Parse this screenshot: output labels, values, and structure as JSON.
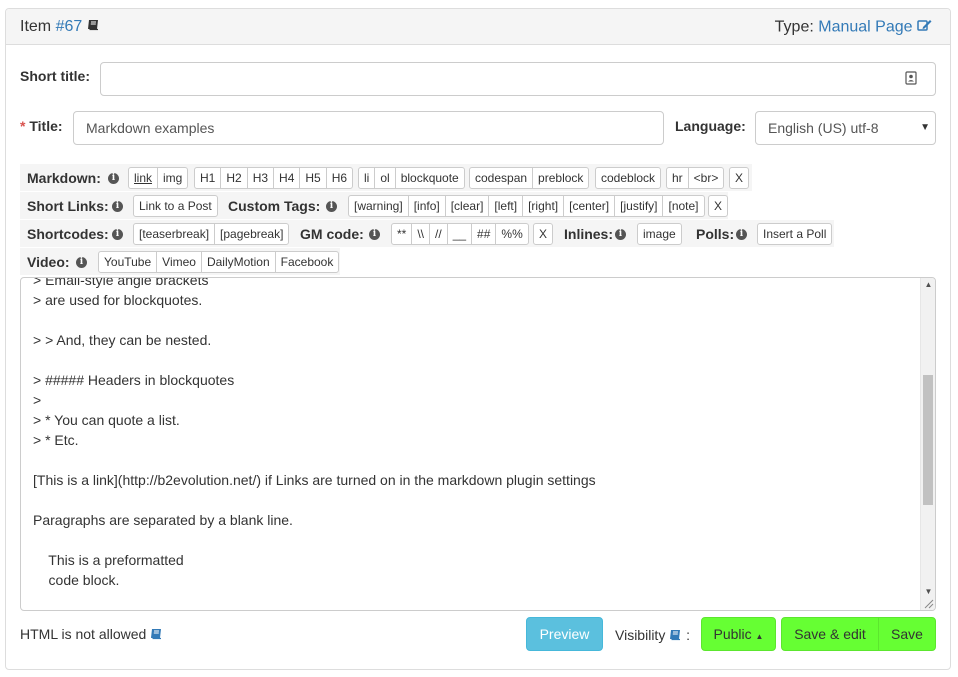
{
  "header": {
    "item_label": "Item",
    "item_number": "#67",
    "type_label": "Type:",
    "type_value": "Manual Page"
  },
  "form": {
    "short_title_label": "Short title:",
    "short_title_value": "",
    "title_required_mark": "*",
    "title_label": "Title:",
    "title_value": "Markdown examples",
    "language_label": "Language:",
    "language_value": "English (US) utf-8"
  },
  "toolbars": {
    "markdown": {
      "label": "Markdown:",
      "groups": [
        [
          "link",
          "img"
        ],
        [
          "H1",
          "H2",
          "H3",
          "H4",
          "H5",
          "H6"
        ],
        [
          "li",
          "ol",
          "blockquote"
        ],
        [
          "codespan",
          "preblock"
        ],
        [
          "codeblock"
        ],
        [
          "hr",
          "<br>"
        ],
        [
          "X"
        ]
      ]
    },
    "short_links": {
      "label": "Short Links:",
      "buttons": [
        "Link to a Post"
      ]
    },
    "custom_tags": {
      "label": "Custom Tags:",
      "groups": [
        [
          "[warning]",
          "[info]",
          "[clear]",
          "[left]",
          "[right]",
          "[center]",
          "[justify]",
          "[note]"
        ],
        [
          "X"
        ]
      ]
    },
    "shortcodes": {
      "label": "Shortcodes:",
      "buttons": [
        "[teaserbreak]",
        "[pagebreak]"
      ]
    },
    "gm_code": {
      "label": "GM code:",
      "groups": [
        [
          "**",
          "\\\\",
          "//",
          "__",
          "##",
          "%%"
        ],
        [
          "X"
        ]
      ]
    },
    "inlines": {
      "label": "Inlines:",
      "buttons": [
        "image"
      ]
    },
    "polls": {
      "label": "Polls:",
      "buttons": [
        "Insert a Poll"
      ]
    },
    "video": {
      "label": "Video:",
      "buttons": [
        "YouTube",
        "Vimeo",
        "DailyMotion",
        "Facebook"
      ]
    }
  },
  "editor": {
    "content": "> Email-style angle brackets\n> are used for blockquotes.\n\n> > And, they can be nested.\n\n> ##### Headers in blockquotes\n>\n> * You can quote a list.\n> * Etc.\n\n[This is a link](http://b2evolution.net/) if Links are turned on in the markdown plugin settings\n\nParagraphs are separated by a blank line.\n\n    This is a preformatted\n    code block."
  },
  "footer": {
    "html_notice": "HTML is not allowed",
    "preview_label": "Preview",
    "visibility_label": "Visibility",
    "visibility_colon": ":",
    "visibility_value": "Public",
    "save_edit_label": "Save & edit",
    "save_label": "Save"
  },
  "colors": {
    "link": "#337ab7",
    "preview_button": "#5bc0de",
    "save_button": "#66ff33",
    "required": "#d9534f"
  },
  "icons": [
    "book-icon",
    "edit-icon",
    "info-icon",
    "contact-card-icon",
    "caret-down-icon",
    "caret-up-icon"
  ]
}
